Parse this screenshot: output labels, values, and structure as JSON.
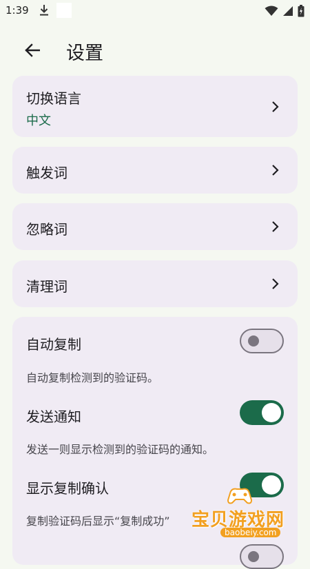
{
  "status_bar": {
    "time": "1:39",
    "icons": [
      "download-icon",
      "wifi-icon",
      "signal-icon",
      "battery-icon"
    ]
  },
  "app_bar": {
    "title": "设置",
    "back_icon": "arrow-left-icon"
  },
  "settings": {
    "language": {
      "title": "切换语言",
      "value": "中文"
    },
    "nav_items": [
      {
        "title": "触发词"
      },
      {
        "title": "忽略词"
      },
      {
        "title": "清理词"
      }
    ],
    "toggles": [
      {
        "title": "自动复制",
        "description": "自动复制检测到的验证码。",
        "enabled": false
      },
      {
        "title": "发送通知",
        "description": "发送一则显示检测到的验证码的通知。",
        "enabled": true
      },
      {
        "title": "显示复制确认",
        "description": "复制验证码后显示“复制成功”",
        "enabled": true
      }
    ]
  },
  "watermark": {
    "text": "宝贝游戏网",
    "url": "baobeiy.com"
  },
  "colors": {
    "background": "#f5f8f1",
    "card": "#f0ebf4",
    "accent": "#1b6b4a",
    "text": "#1e1d21",
    "secondary_text": "#47464c",
    "toggle_off": "#7a757f",
    "watermark": "#f2a020"
  }
}
